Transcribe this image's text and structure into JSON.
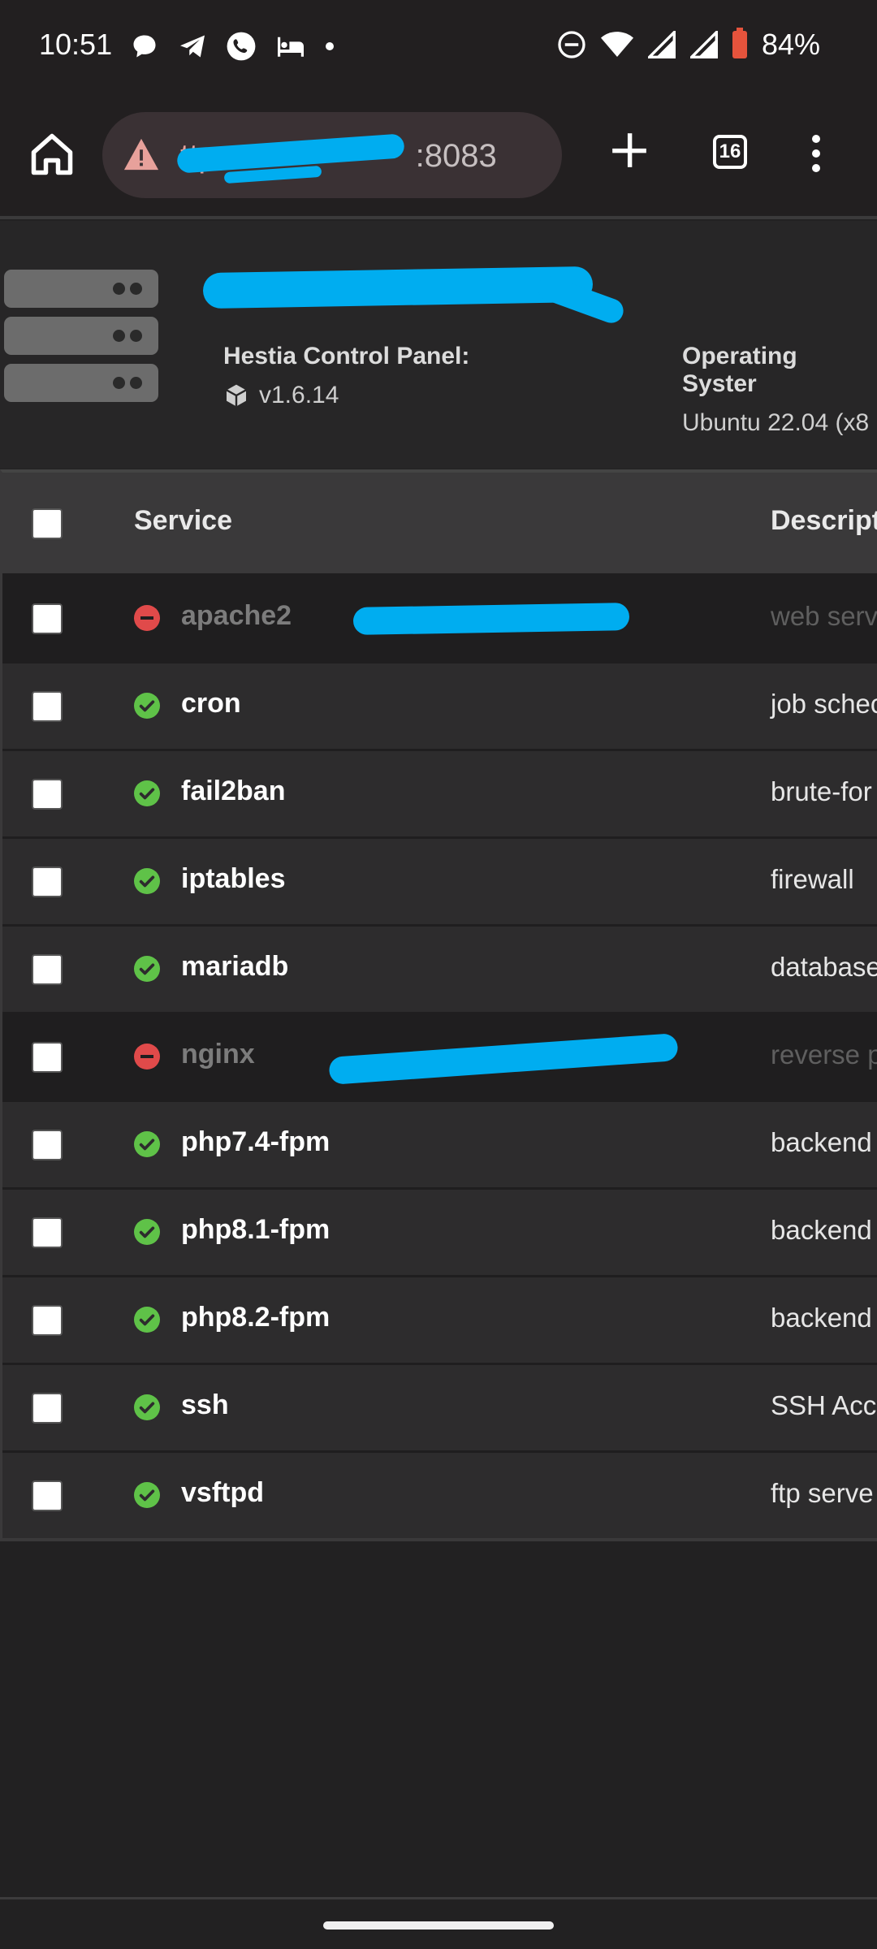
{
  "status_bar": {
    "time": "10:51",
    "battery": "84%"
  },
  "browser": {
    "url_scheme": "ttps:",
    "url_port": ":8083",
    "tab_count": "16"
  },
  "header": {
    "panel_label": "Hestia Control Panel:",
    "panel_version": "v1.6.14",
    "os_label": "Operating Syster",
    "os_value": "Ubuntu 22.04 (x8"
  },
  "table": {
    "col_service": "Service",
    "col_description": "Descript",
    "rows": [
      {
        "name": "apache2",
        "desc": "web serv",
        "running": false
      },
      {
        "name": "cron",
        "desc": "job schec",
        "running": true
      },
      {
        "name": "fail2ban",
        "desc": "brute-for",
        "running": true
      },
      {
        "name": "iptables",
        "desc": "firewall",
        "running": true
      },
      {
        "name": "mariadb",
        "desc": "database",
        "running": true
      },
      {
        "name": "nginx",
        "desc": "reverse p",
        "running": false
      },
      {
        "name": "php7.4-fpm",
        "desc": "backend",
        "running": true
      },
      {
        "name": "php8.1-fpm",
        "desc": "backend",
        "running": true
      },
      {
        "name": "php8.2-fpm",
        "desc": "backend",
        "running": true
      },
      {
        "name": "ssh",
        "desc": "SSH Acce",
        "running": true
      },
      {
        "name": "vsftpd",
        "desc": "ftp serve",
        "running": true
      }
    ]
  },
  "colors": {
    "running": "#5fc248",
    "stopped": "#e04a4a",
    "redaction": "#00adf0"
  }
}
